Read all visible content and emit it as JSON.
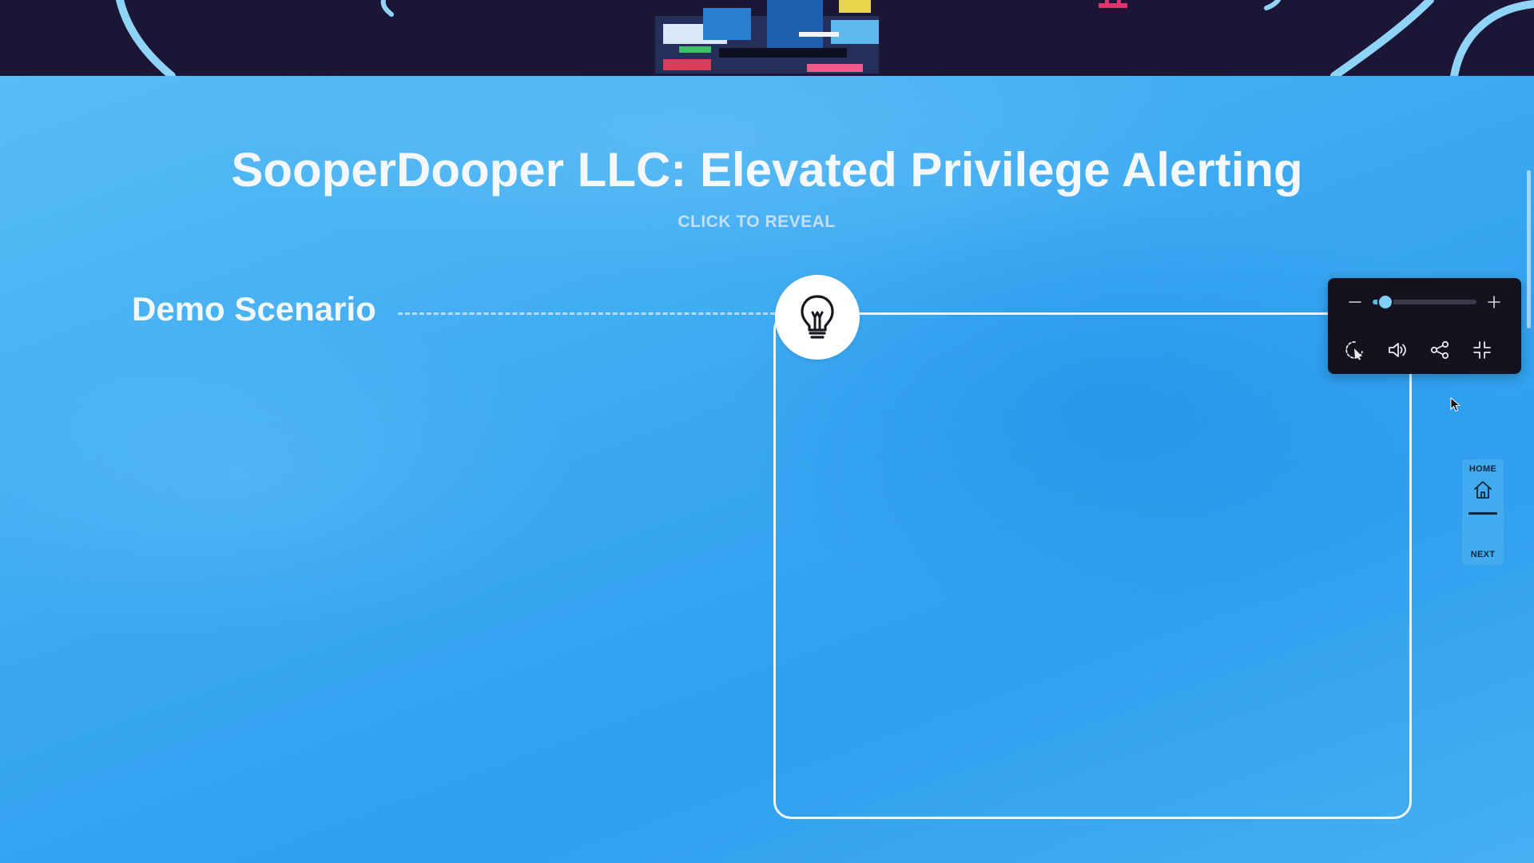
{
  "presentation": {
    "title": "SooperDooper LLC: Elevated Privilege Alerting",
    "reveal_label": "CLICK TO REVEAL",
    "scenario_label": "Demo Scenario",
    "content_icon": "lightbulb-icon"
  },
  "controls": {
    "zoom_level": 0.12,
    "zoom_out_icon": "minus-icon",
    "zoom_in_icon": "plus-icon",
    "buttons": [
      {
        "name": "autoplay-button",
        "icon": "cursor-loop-icon"
      },
      {
        "name": "audio-button",
        "icon": "speaker-icon"
      },
      {
        "name": "share-button",
        "icon": "share-icon"
      },
      {
        "name": "exit-fullscreen-button",
        "icon": "collapse-icon"
      }
    ]
  },
  "navigation": {
    "home_label": "HOME",
    "next_label": "NEXT",
    "home_icon": "home-icon"
  },
  "colors": {
    "background": "#3eaaf0",
    "banner": "#1b1536",
    "panel": "#14121e",
    "accent": "#5ab6e6",
    "text": "#f4f8fc"
  }
}
